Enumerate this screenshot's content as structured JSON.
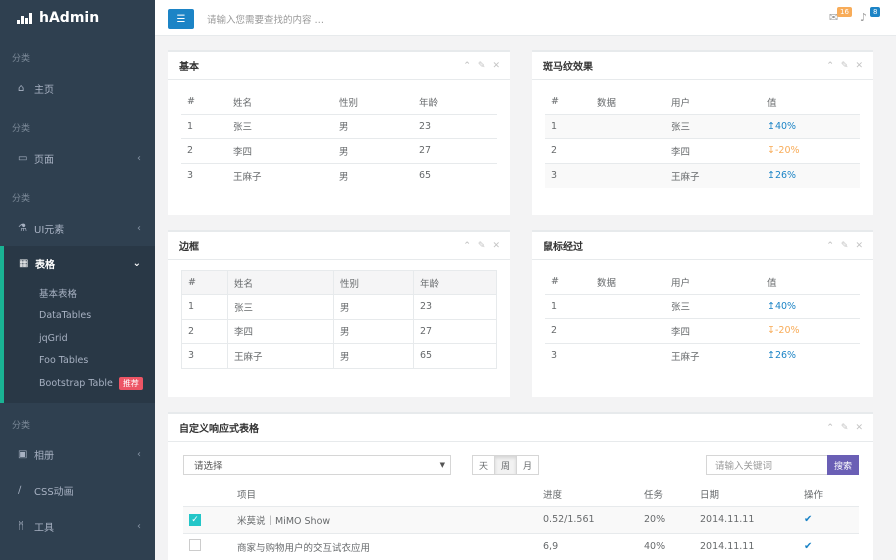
{
  "app": {
    "name": "hAdmin"
  },
  "sidebar": {
    "section_label": "分类",
    "items": [
      {
        "label": "主页",
        "icon": "home-icon"
      },
      {
        "label": "页面",
        "icon": "desktop-icon"
      },
      {
        "label": "UI元素",
        "icon": "flask-icon"
      },
      {
        "label": "表格",
        "icon": "table-icon"
      },
      {
        "label": "相册",
        "icon": "picture-icon"
      },
      {
        "label": "CSS动画",
        "icon": "magic-icon"
      },
      {
        "label": "工具",
        "icon": "cutlery-icon"
      }
    ],
    "submenu": [
      "基本表格",
      "DataTables",
      "jqGrid",
      "Foo Tables",
      "Bootstrap Table"
    ],
    "hot_badge": "推荐"
  },
  "topbar": {
    "search_placeholder": "请输入您需要查找的内容 …",
    "mail_count": "16",
    "bell_count": "8"
  },
  "panels": {
    "basic": {
      "title": "基本"
    },
    "striped": {
      "title": "斑马纹效果"
    },
    "bordered": {
      "title": "边框"
    },
    "hover": {
      "title": "鼠标经过"
    },
    "custom": {
      "title": "自定义响应式表格"
    }
  },
  "people_table": {
    "headers": [
      "#",
      "姓名",
      "性别",
      "年龄"
    ],
    "rows": [
      [
        "1",
        "张三",
        "男",
        "23"
      ],
      [
        "2",
        "李四",
        "男",
        "27"
      ],
      [
        "3",
        "王麻子",
        "男",
        "65"
      ]
    ]
  },
  "stats_table": {
    "headers": [
      "#",
      "数据",
      "用户",
      "值"
    ],
    "rows": [
      [
        "1",
        "",
        "张三",
        "40%"
      ],
      [
        "2",
        "",
        "李四",
        "-20%"
      ],
      [
        "3",
        "",
        "王麻子",
        "26%"
      ]
    ]
  },
  "custom_table": {
    "select_value": "请选择",
    "range_buttons": [
      "天",
      "周",
      "月"
    ],
    "keyword_placeholder": "请输入关键词",
    "search_label": "搜索",
    "headers": [
      "",
      "项目",
      "进度",
      "任务",
      "日期",
      "操作"
    ],
    "rows": [
      [
        "",
        "米莫说｜MiMO Show",
        "0.52/1.561",
        "20%",
        "2014.11.11",
        ""
      ],
      [
        "",
        "商家与购物用户的交互试衣应用",
        "6,9",
        "40%",
        "2014.11.11",
        ""
      ]
    ]
  },
  "colors": {
    "sidebar": "#2f4050",
    "accent": "#1ab394",
    "primary": "#1c84c6",
    "warning": "#f8ac59"
  }
}
